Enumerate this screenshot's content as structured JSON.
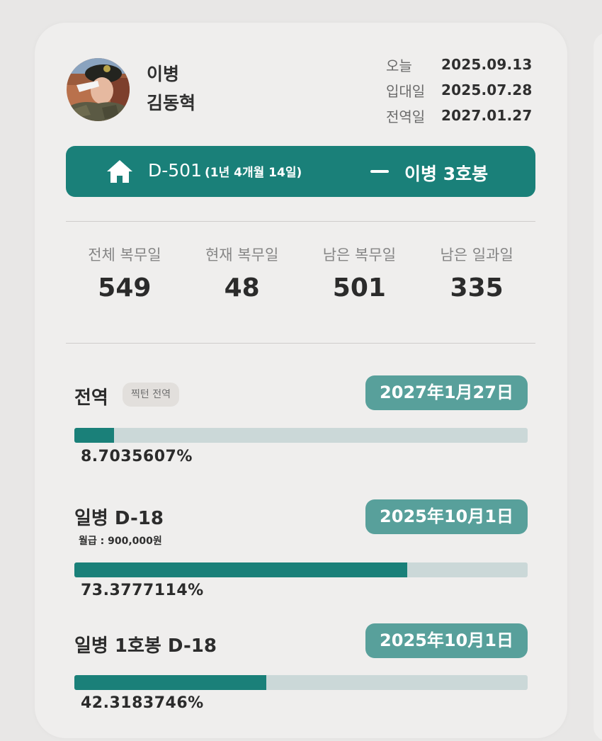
{
  "profile": {
    "rank": "이병",
    "name": "김동혁",
    "avatar": "soldier-saluting-photo"
  },
  "dates": [
    {
      "label": "오늘",
      "value": "2025.09.13"
    },
    {
      "label": "입대일",
      "value": "2025.07.28"
    },
    {
      "label": "전역일",
      "value": "2027.01.27"
    }
  ],
  "banner": {
    "icon": "home-icon",
    "dday": "D-501",
    "dday_detail": "(1년 4개월 14일)",
    "rank_step": "이병 3호봉",
    "color": "#1a8079"
  },
  "stats": [
    {
      "label": "전체 복무일",
      "value": "549"
    },
    {
      "label": "현재 복무일",
      "value": "48"
    },
    {
      "label": "남은 복무일",
      "value": "501"
    },
    {
      "label": "남은 일과일",
      "value": "335"
    }
  ],
  "progress": [
    {
      "title": "전역",
      "tag": "찍턴 전역",
      "date": "2027年1月27日",
      "percent_text": "8.7035607%",
      "fraction": 0.087035607
    },
    {
      "title": "일병 D-18",
      "salary": "월급 : 900,000원",
      "date": "2025年10月1日",
      "percent_text": "73.3777114%",
      "fraction": 0.733777114
    },
    {
      "title": "일병 1호봉 D-18",
      "date": "2025年10月1日",
      "percent_text": "42.3183746%",
      "fraction": 0.423183746
    }
  ],
  "colors": {
    "accent": "#1a8079",
    "badge": "#58a09b",
    "track": "#cbd8d8"
  }
}
